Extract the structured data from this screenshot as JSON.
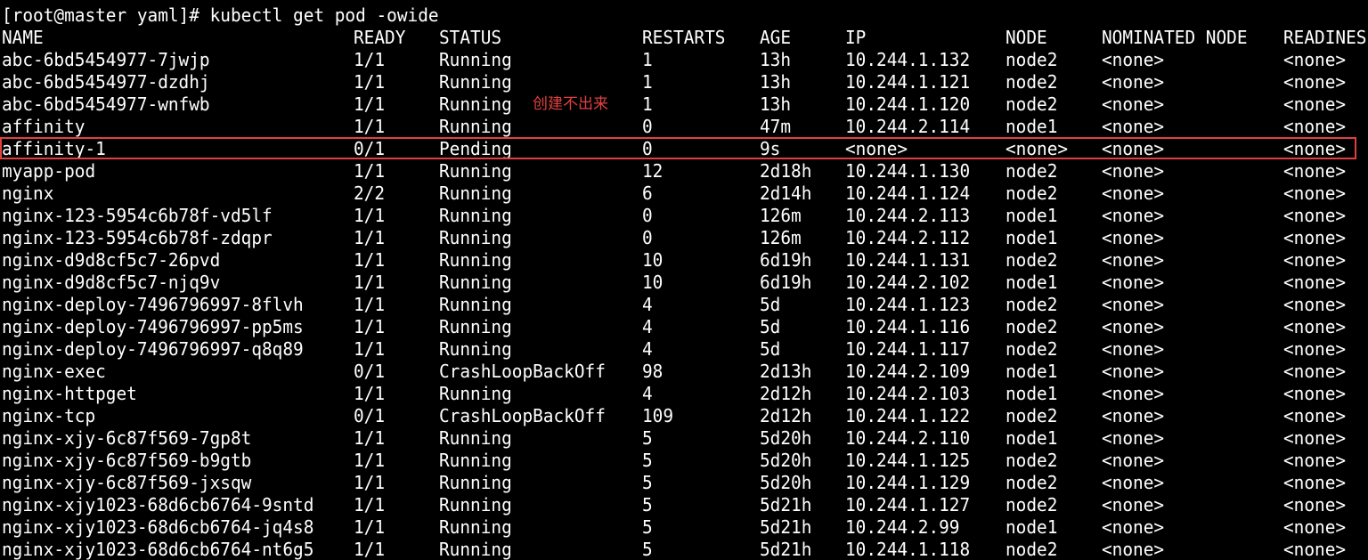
{
  "terminal": {
    "prompt": "[root@master yaml]# kubectl get pod -owide",
    "headers": [
      "NAME",
      "READY",
      "STATUS",
      "RESTARTS",
      "AGE",
      "IP",
      "NODE",
      "NOMINATED NODE",
      "READINES"
    ],
    "rows": [
      [
        "abc-6bd5454977-7jwjp",
        "1/1",
        "Running",
        "1",
        "13h",
        "10.244.1.132",
        "node2",
        "<none>",
        "<none>"
      ],
      [
        "abc-6bd5454977-dzdhj",
        "1/1",
        "Running",
        "1",
        "13h",
        "10.244.1.121",
        "node2",
        "<none>",
        "<none>"
      ],
      [
        "abc-6bd5454977-wnfwb",
        "1/1",
        "Running",
        "1",
        "13h",
        "10.244.1.120",
        "node2",
        "<none>",
        "<none>"
      ],
      [
        "affinity",
        "1/1",
        "Running",
        "0",
        "47m",
        "10.244.2.114",
        "node1",
        "<none>",
        "<none>"
      ],
      [
        "affinity-1",
        "0/1",
        "Pending",
        "0",
        "9s",
        "<none>",
        "<none>",
        "<none>",
        "<none>"
      ],
      [
        "myapp-pod",
        "1/1",
        "Running",
        "12",
        "2d18h",
        "10.244.1.130",
        "node2",
        "<none>",
        "<none>"
      ],
      [
        "nginx",
        "2/2",
        "Running",
        "6",
        "2d14h",
        "10.244.1.124",
        "node2",
        "<none>",
        "<none>"
      ],
      [
        "nginx-123-5954c6b78f-vd5lf",
        "1/1",
        "Running",
        "0",
        "126m",
        "10.244.2.113",
        "node1",
        "<none>",
        "<none>"
      ],
      [
        "nginx-123-5954c6b78f-zdqpr",
        "1/1",
        "Running",
        "0",
        "126m",
        "10.244.2.112",
        "node1",
        "<none>",
        "<none>"
      ],
      [
        "nginx-d9d8cf5c7-26pvd",
        "1/1",
        "Running",
        "10",
        "6d19h",
        "10.244.1.131",
        "node2",
        "<none>",
        "<none>"
      ],
      [
        "nginx-d9d8cf5c7-njq9v",
        "1/1",
        "Running",
        "10",
        "6d19h",
        "10.244.2.102",
        "node1",
        "<none>",
        "<none>"
      ],
      [
        "nginx-deploy-7496796997-8flvh",
        "1/1",
        "Running",
        "4",
        "5d",
        "10.244.1.123",
        "node2",
        "<none>",
        "<none>"
      ],
      [
        "nginx-deploy-7496796997-pp5ms",
        "1/1",
        "Running",
        "4",
        "5d",
        "10.244.1.116",
        "node2",
        "<none>",
        "<none>"
      ],
      [
        "nginx-deploy-7496796997-q8q89",
        "1/1",
        "Running",
        "4",
        "5d",
        "10.244.1.117",
        "node2",
        "<none>",
        "<none>"
      ],
      [
        "nginx-exec",
        "0/1",
        "CrashLoopBackOff",
        "98",
        "2d13h",
        "10.244.2.109",
        "node1",
        "<none>",
        "<none>"
      ],
      [
        "nginx-httpget",
        "1/1",
        "Running",
        "4",
        "2d12h",
        "10.244.2.103",
        "node1",
        "<none>",
        "<none>"
      ],
      [
        "nginx-tcp",
        "0/1",
        "CrashLoopBackOff",
        "109",
        "2d12h",
        "10.244.1.122",
        "node2",
        "<none>",
        "<none>"
      ],
      [
        "nginx-xjy-6c87f569-7gp8t",
        "1/1",
        "Running",
        "5",
        "5d20h",
        "10.244.2.110",
        "node1",
        "<none>",
        "<none>"
      ],
      [
        "nginx-xjy-6c87f569-b9gtb",
        "1/1",
        "Running",
        "5",
        "5d20h",
        "10.244.1.125",
        "node2",
        "<none>",
        "<none>"
      ],
      [
        "nginx-xjy-6c87f569-jxsqw",
        "1/1",
        "Running",
        "5",
        "5d20h",
        "10.244.1.129",
        "node2",
        "<none>",
        "<none>"
      ],
      [
        "nginx-xjy1023-68d6cb6764-9sntd",
        "1/1",
        "Running",
        "5",
        "5d21h",
        "10.244.1.127",
        "node2",
        "<none>",
        "<none>"
      ],
      [
        "nginx-xjy1023-68d6cb6764-jq4s8",
        "1/1",
        "Running",
        "5",
        "5d21h",
        "10.244.2.99",
        "node1",
        "<none>",
        "<none>"
      ],
      [
        "nginx-xjy1023-68d6cb6764-nt6g5",
        "1/1",
        "Running",
        "5",
        "5d21h",
        "10.244.1.118",
        "node2",
        "<none>",
        "<none>"
      ]
    ]
  },
  "annotation": {
    "text": "创建不出来",
    "color": "#e0413f"
  },
  "colors": {
    "background": "#000000",
    "foreground": "#ffffff",
    "highlight": "#e0413f"
  }
}
